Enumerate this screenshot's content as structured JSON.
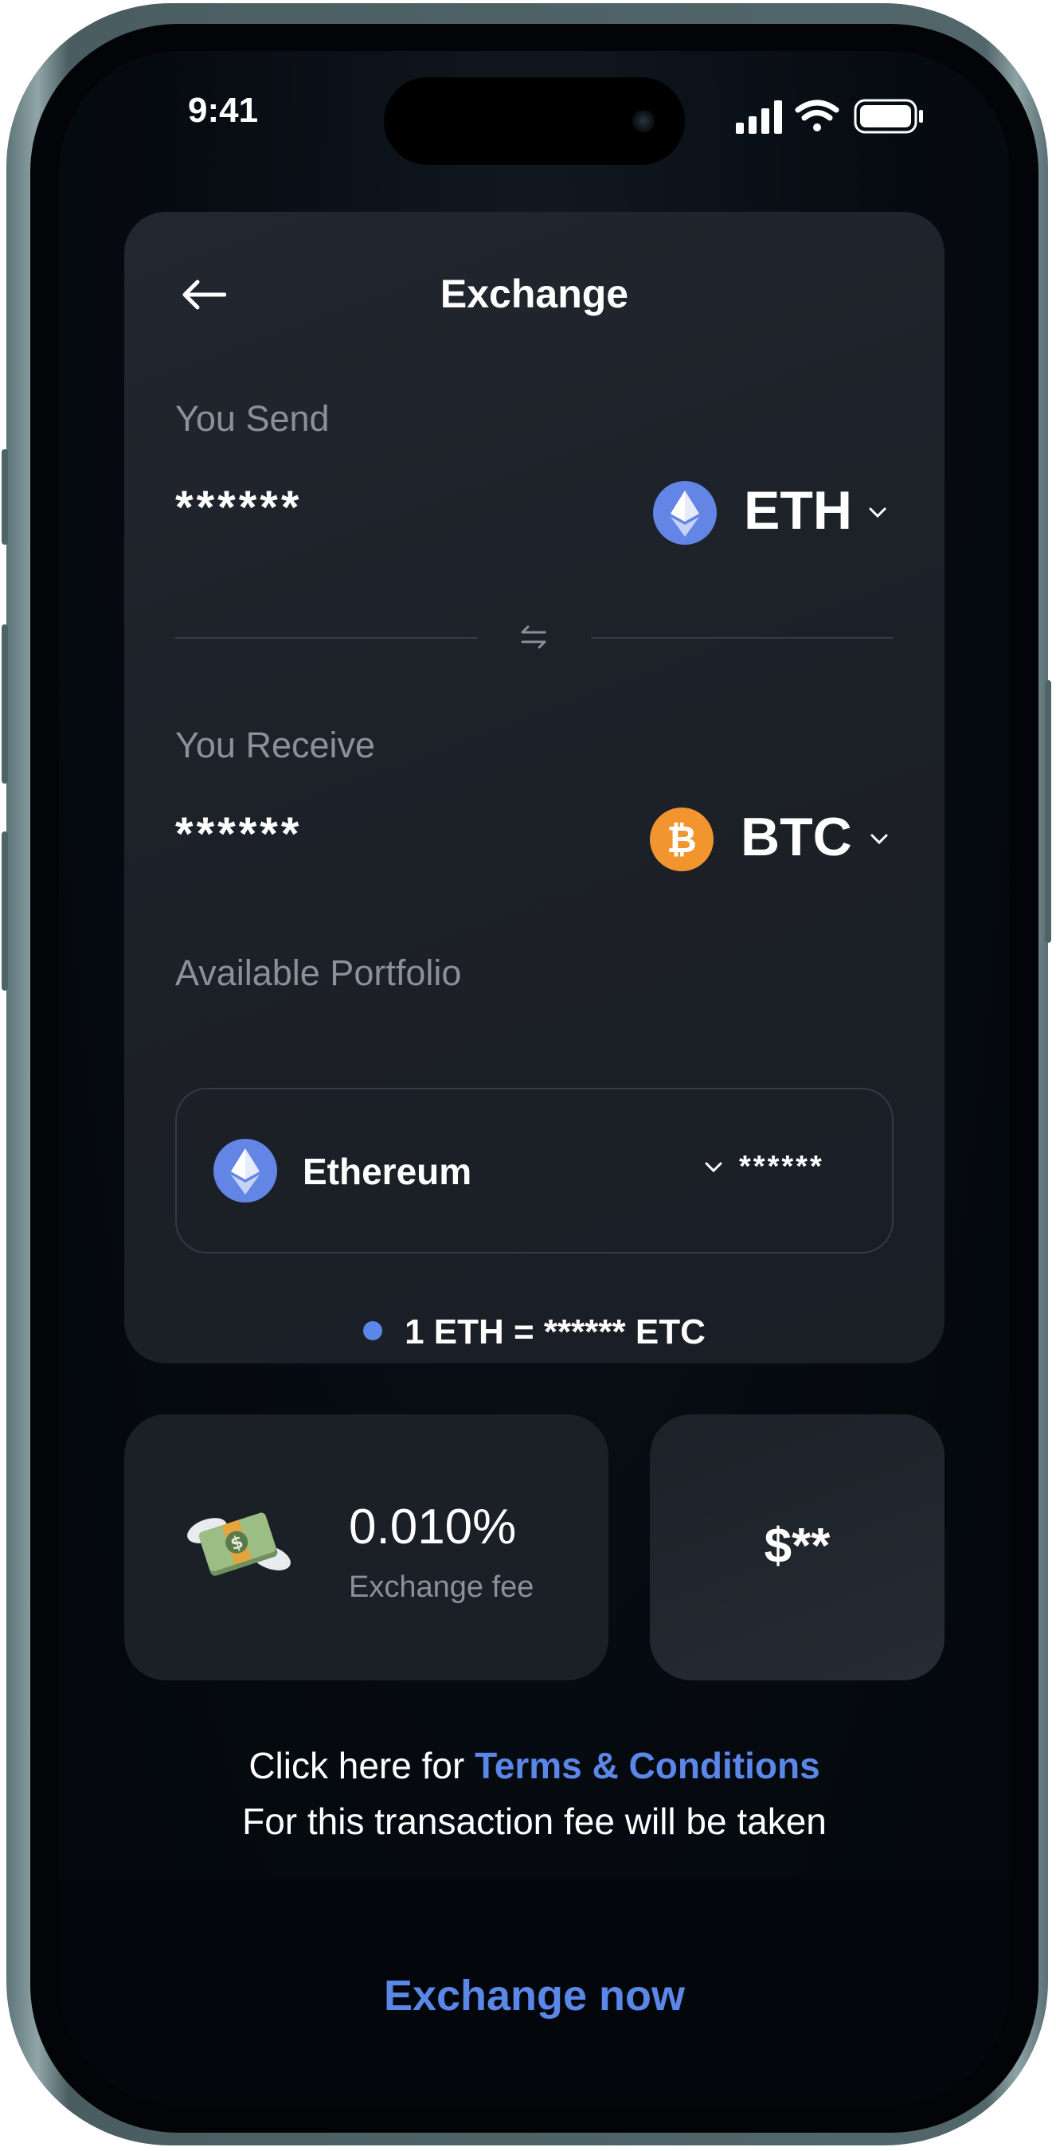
{
  "status_bar": {
    "time": "9:41"
  },
  "header": {
    "title": "Exchange"
  },
  "send": {
    "label": "You Send",
    "amount": "******",
    "currency": "ETH"
  },
  "receive": {
    "label": "You Receive",
    "amount": "******",
    "currency": "BTC"
  },
  "portfolio": {
    "label": "Available Portfolio",
    "asset": "Ethereum",
    "balance": "******"
  },
  "rate": {
    "text": "1 ETH = ****** ETC"
  },
  "fee": {
    "value": "0.010%",
    "label": "Exchange fee"
  },
  "amount_card": {
    "value": "$**"
  },
  "terms": {
    "prefix": "Click here for ",
    "link": "Terms & Conditions",
    "note": "For this transaction fee will be taken"
  },
  "actions": {
    "exchange_label": "Exchange now"
  },
  "colors": {
    "accent": "#5b87e8",
    "eth": "#6285e6",
    "btc": "#f2952f",
    "card": "#1c2027"
  }
}
